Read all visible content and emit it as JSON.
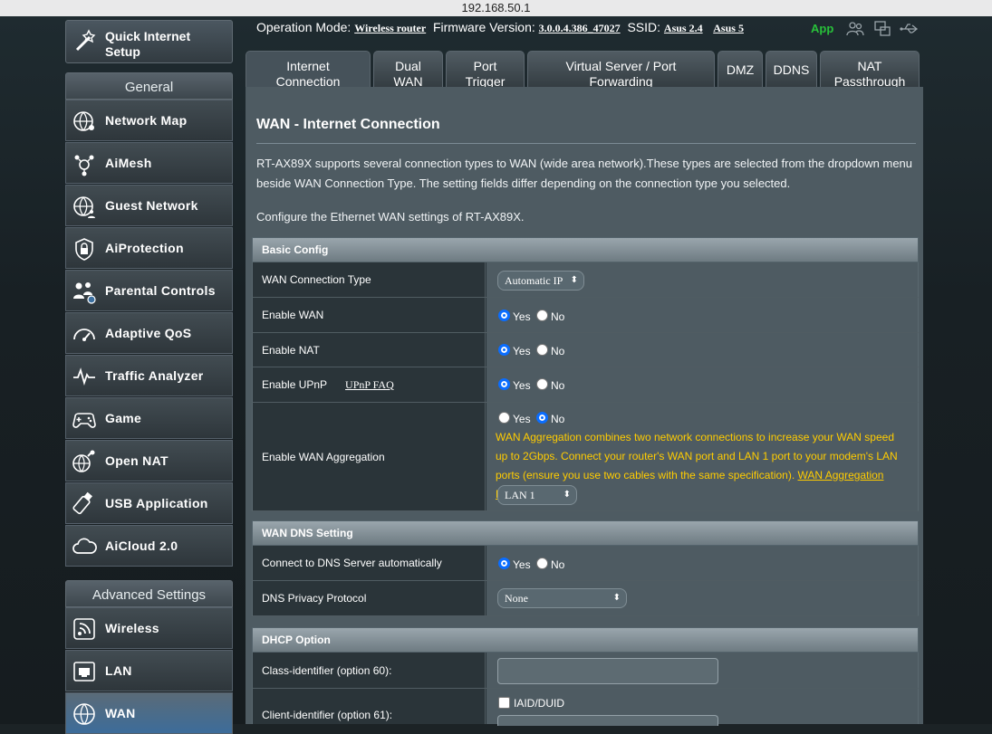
{
  "browser": {
    "url": "192.168.50.1"
  },
  "sidebar": {
    "quick_setup": "Quick Internet Setup",
    "general_head": "General",
    "general": [
      "Network Map",
      "AiMesh",
      "Guest Network",
      "AiProtection",
      "Parental Controls",
      "Adaptive QoS",
      "Traffic Analyzer",
      "Game",
      "Open NAT",
      "USB Application",
      "AiCloud 2.0"
    ],
    "advanced_head": "Advanced Settings",
    "advanced": [
      "Wireless",
      "LAN",
      "WAN"
    ]
  },
  "topbar": {
    "mode_label": "Operation Mode:",
    "mode_value": "Wireless router",
    "fw_label": "Firmware Version:",
    "fw_value": "3.0.0.4.386_47027",
    "ssid_label": "SSID:",
    "ssid1": "Asus 2.4",
    "ssid2": "Asus 5",
    "app": "App"
  },
  "tabs": [
    {
      "line1": "Internet",
      "line2": "Connection"
    },
    {
      "line1": "Dual",
      "line2": "WAN"
    },
    {
      "line1": "Port",
      "line2": "Trigger"
    },
    {
      "line1": "Virtual Server / Port",
      "line2": "Forwarding"
    },
    {
      "line1": "DMZ",
      "line2": ""
    },
    {
      "line1": "DDNS",
      "line2": ""
    },
    {
      "line1": "NAT",
      "line2": "Passthrough"
    }
  ],
  "main": {
    "title": "WAN - Internet Connection",
    "desc1a": "RT-AX89X supports several connection types to WAN (wide area network).These types are selected from the dropdown menu",
    "desc1b": "beside WAN Connection Type. The setting fields differ depending on the connection type you selected.",
    "desc2": "Configure the Ethernet WAN settings of RT-AX89X."
  },
  "basic": {
    "head": "Basic Config",
    "conn_type_label": "WAN Connection Type",
    "conn_type_value": "Automatic IP",
    "enable_wan": "Enable WAN",
    "enable_nat": "Enable NAT",
    "enable_upnp": "Enable UPnP",
    "upnp_faq": "UPnP FAQ",
    "aggregation": "Enable WAN Aggregation",
    "agg_note": "WAN Aggregation combines two network connections to increase your WAN speed up to 2Gbps. Connect your router's WAN port and LAN 1 port to your modem's LAN ports (ensure you use two cables with the same specification).",
    "agg_faq": "WAN Aggregation FAQ",
    "agg_port": "LAN 1",
    "yes": "Yes",
    "no": "No"
  },
  "dns": {
    "head": "WAN DNS Setting",
    "auto_label": "Connect to DNS Server automatically",
    "privacy_label": "DNS Privacy Protocol",
    "privacy_value": "None"
  },
  "dhcp": {
    "head": "DHCP Option",
    "class_label": "Class-identifier (option 60):",
    "client_label": "Client-identifier (option 61):",
    "iaid": "IAID/DUID"
  }
}
